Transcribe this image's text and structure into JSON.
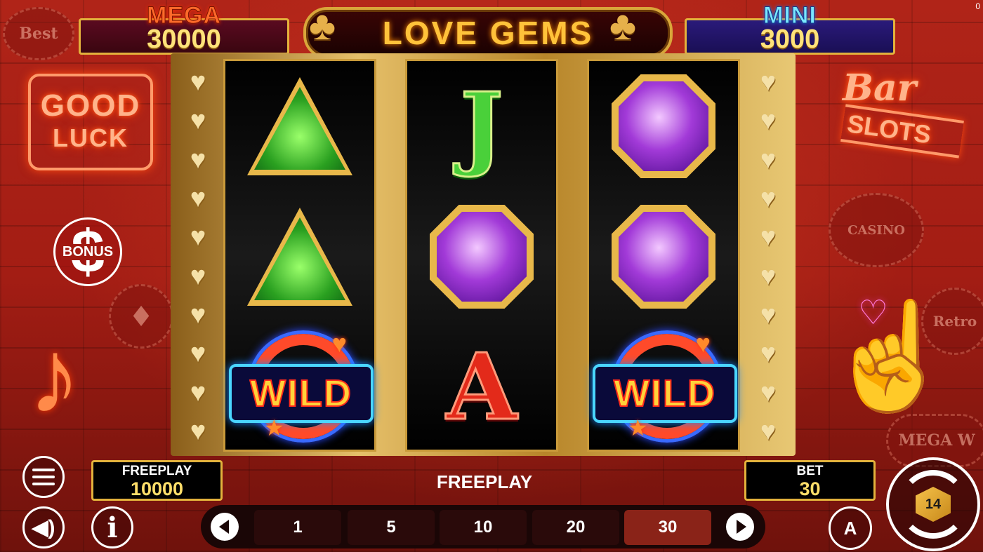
{
  "jackpots": {
    "mega": {
      "label": "MEGA",
      "value": "30000"
    },
    "mini": {
      "label": "MINI",
      "value": "3000"
    }
  },
  "title": "LOVE GEMS",
  "decor": {
    "good_luck_line1": "GOOD",
    "good_luck_line2": "LUCK",
    "bar_script": "Bar",
    "bar_slots": "SLOTS",
    "badge_best": "Best",
    "badge_casino": "CASINO",
    "badge_retro": "Retro",
    "badge_mega": "MEGA W"
  },
  "bonus_button": {
    "symbol": "$",
    "label": "BONUS"
  },
  "reels": [
    [
      "green-triangle-gem",
      "green-triangle-gem",
      "wild"
    ],
    [
      "letter-j",
      "purple-octagon-gem",
      "letter-a"
    ],
    [
      "purple-octagon-gem",
      "purple-octagon-gem",
      "wild"
    ]
  ],
  "symbols": {
    "wild_text": "WILD",
    "j": "J",
    "a": "A"
  },
  "freeplay_box": {
    "label": "FREEPLAY",
    "value": "10000"
  },
  "status_message": "FREEPLAY",
  "bet_box": {
    "label": "BET",
    "value": "30"
  },
  "bet_options": [
    "1",
    "5",
    "10",
    "20",
    "30"
  ],
  "selected_bet": "30",
  "spin_badge": "14",
  "auto_label": "A",
  "corner_count": "0",
  "icons": {
    "menu": "menu-icon",
    "sound": "speaker-icon",
    "info": "info-icon",
    "auto": "autoplay-icon",
    "spin": "spin-icon",
    "prev": "arrow-left-icon",
    "next": "arrow-right-icon"
  },
  "colors": {
    "gold": "#e3b23c",
    "bet_selected": "#8a2318",
    "value_yellow": "#ffdf6a"
  }
}
